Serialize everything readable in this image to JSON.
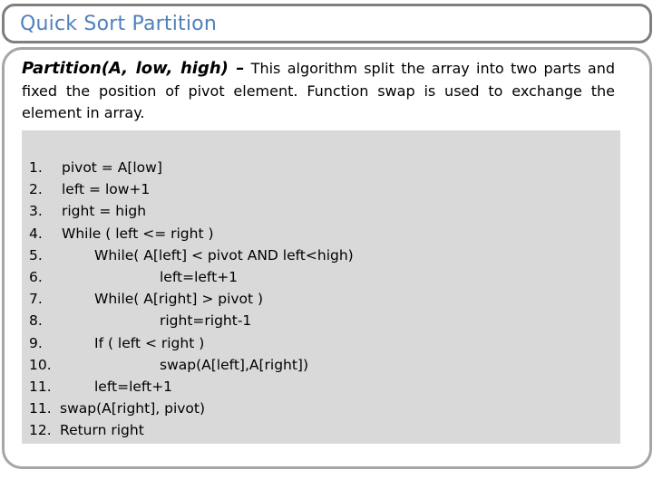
{
  "slide": {
    "title": "Quick Sort Partition",
    "intro": {
      "signature": "Partition(A, low, high) –",
      "description": " This algorithm split the array into two parts and fixed the position of pivot element. Function swap is used to exchange the element in array."
    },
    "code": [
      {
        "number": "1.",
        "text": "pivot = A[low]",
        "indent": 0
      },
      {
        "number": "2.",
        "text": "left = low+1",
        "indent": 0
      },
      {
        "number": "3.",
        "text": "right = high",
        "indent": 0
      },
      {
        "number": "4.",
        "text": "While ( left <= right )",
        "indent": 0
      },
      {
        "number": "5.",
        "text": "While( A[left] < pivot AND left<high)",
        "indent": 1
      },
      {
        "number": "6.",
        "text": "left=left+1",
        "indent": 2
      },
      {
        "number": "7.",
        "text": "While( A[right] > pivot )",
        "indent": 1
      },
      {
        "number": "8.",
        "text": "right=right-1",
        "indent": 2
      },
      {
        "number": "9.",
        "text": "If ( left < right )",
        "indent": 1
      },
      {
        "number": "10.",
        "text": "swap(A[left],A[right])",
        "indent": 2
      },
      {
        "number": "11.",
        "text": "left=left+1",
        "indent": 1
      },
      {
        "number": "11.",
        "text": "swap(A[right], pivot)",
        "indent": 0
      },
      {
        "number": "12.",
        "text": "Return right",
        "indent": 0
      }
    ]
  },
  "colors": {
    "title": "#4f81bd",
    "title_border": "#7f7f7f",
    "body_border": "#a6a6a6",
    "code_background": "#d9d9d9"
  }
}
